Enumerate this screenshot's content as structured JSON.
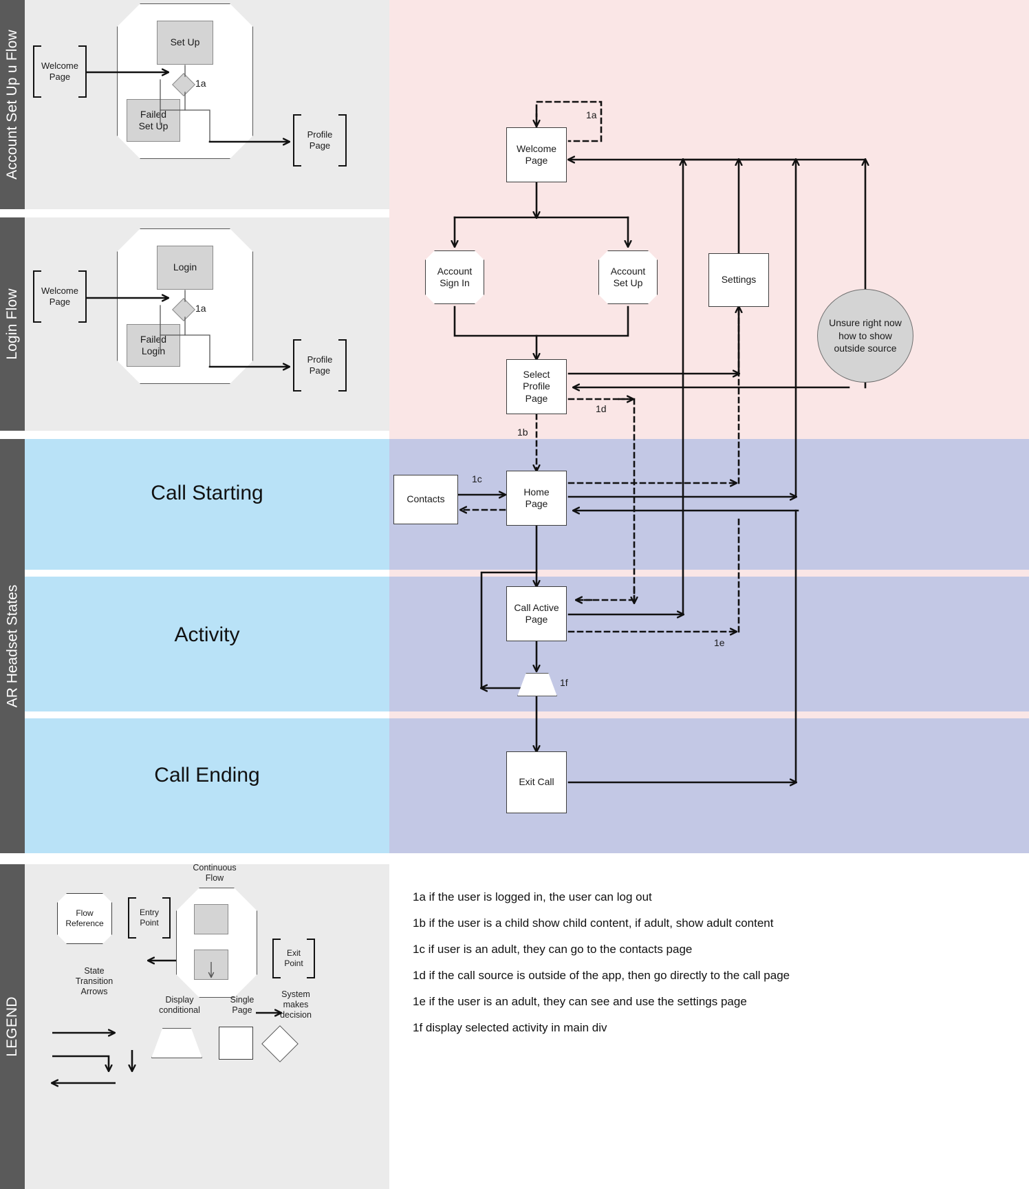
{
  "bands": [
    {
      "key": "account_setup",
      "label": "Account Set Up u Flow",
      "title": "",
      "bg": "#ebebeb"
    },
    {
      "key": "login",
      "label": "Login Flow",
      "title": "",
      "bg": "#ebebeb"
    },
    {
      "key": "call_starting",
      "label": "",
      "title": "Call Starting",
      "bg": "#b9e2f7"
    },
    {
      "key": "activity",
      "label": "AR Headset States",
      "title": "Activity",
      "bg": "#b9e2f7"
    },
    {
      "key": "call_ending",
      "label": "",
      "title": "Call Ending",
      "bg": "#b9e2f7"
    },
    {
      "key": "legend",
      "label": "LEGEND",
      "title": "",
      "bg": "#ebebeb"
    }
  ],
  "colors": {
    "band_label_bg": "#5a5a5a",
    "panel_grey": "#ebebeb",
    "band_blue": "#b9e2f7",
    "overlay_pink": "#fae6e6",
    "overlay_purple": "#c3c8e5",
    "node_fill": "#ffffff",
    "node_grey_fill": "#d4d4d4",
    "stroke": "#333333"
  },
  "account_setup_flow": {
    "entry_point": "Welcome\nPage",
    "primary": "Set Up",
    "failed": "Failed\nSet Up",
    "decision_label": "1a",
    "exit_point": "Profile\nPage"
  },
  "login_flow": {
    "entry_point": "Welcome\nPage",
    "primary": "Login",
    "failed": "Failed\nLogin",
    "decision_label": "1a",
    "exit_point": "Profile\nPage"
  },
  "main_flow": {
    "nodes": [
      {
        "id": "welcome",
        "label": "Welcome\nPage",
        "shape": "rect"
      },
      {
        "id": "account_sign_in",
        "label": "Account\nSign In",
        "shape": "octagon"
      },
      {
        "id": "account_set_up",
        "label": "Account\nSet Up",
        "shape": "octagon"
      },
      {
        "id": "settings",
        "label": "Settings",
        "shape": "rect"
      },
      {
        "id": "outside_source",
        "label": "Unsure right now how to show outside source",
        "shape": "ellipse"
      },
      {
        "id": "select_profile",
        "label": "Select\nProfile\nPage",
        "shape": "rect"
      },
      {
        "id": "contacts",
        "label": "Contacts",
        "shape": "rect"
      },
      {
        "id": "home",
        "label": "Home\nPage",
        "shape": "rect"
      },
      {
        "id": "call_active",
        "label": "Call Active\nPage",
        "shape": "rect"
      },
      {
        "id": "activity_select",
        "label": "",
        "shape": "trapezoid"
      },
      {
        "id": "exit_call",
        "label": "Exit Call",
        "shape": "rect"
      }
    ],
    "edge_labels": {
      "welcome_logout": "1a",
      "select_profile_to_home": "1b",
      "contacts_to_home": "1c",
      "select_profile_to_call": "1d",
      "call_active_to_settings": "1e",
      "activity_trapezoid": "1f"
    }
  },
  "legend": {
    "flow_reference": "Flow\nReference",
    "entry_point": "Entry\nPoint",
    "exit_point": "Exit\nPoint",
    "continuous_flow": "Continuous\nFlow",
    "state_transition_arrows": "State\nTransition\nArrows",
    "display_conditional": "Display\nconditional",
    "single_page": "Single\nPage",
    "system_makes_decision": "System\nmakes\ndecision"
  },
  "notes": [
    "1a if the user is logged in, the user can log out",
    "1b if the user is a child show child content, if adult, show adult content",
    "1c if user is an adult, they can go to the contacts page",
    "1d if the call source is outside of the app, then go directly to the call page",
    "1e if the user is an adult, they can see and use the settings page",
    "1f display selected activity in main div"
  ]
}
